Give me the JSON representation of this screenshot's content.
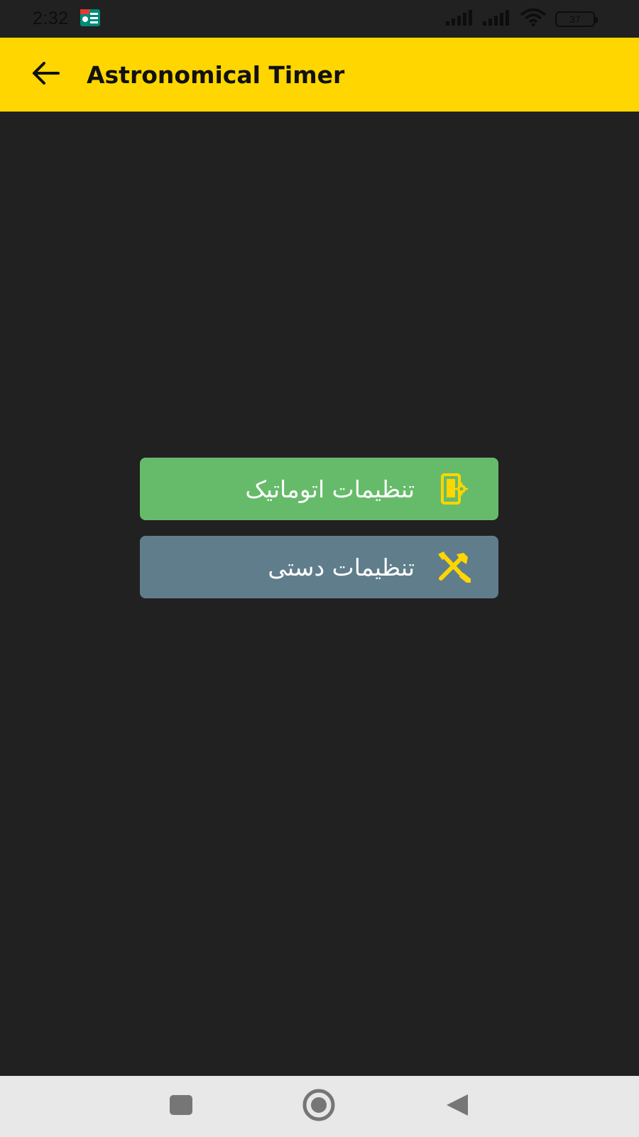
{
  "status_bar": {
    "time": "2:32",
    "battery": "37"
  },
  "app_bar": {
    "title": "Astronomical Timer"
  },
  "buttons": {
    "auto_label": "تنظیمات اتوماتیک",
    "manual_label": "تنظیمات دستی"
  },
  "colors": {
    "accent": "#ffd600",
    "background": "#212121",
    "auto_button": "#66bb6a",
    "manual_button": "#607d8b",
    "icon": "#ffd600"
  },
  "icons": {
    "back": "arrow-left-icon",
    "auto": "phone-settings-icon",
    "manual": "tools-icon",
    "nav_recent": "square-icon",
    "nav_home": "circle-icon",
    "nav_back": "triangle-back-icon"
  }
}
